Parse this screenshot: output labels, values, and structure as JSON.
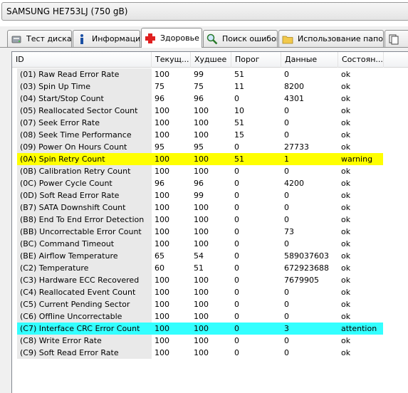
{
  "drive_selector": {
    "value": "SAMSUNG HE753LJ (750 gB)"
  },
  "tabs": [
    {
      "label": "Тест диска",
      "icon": "disk-test-icon",
      "active": false
    },
    {
      "label": "Информация",
      "icon": "info-icon",
      "active": false
    },
    {
      "label": "Здоровье",
      "icon": "health-cross-icon",
      "active": true
    },
    {
      "label": "Поиск ошибок",
      "icon": "search-icon",
      "active": false
    },
    {
      "label": "Использование папок",
      "icon": "folder-icon",
      "active": false
    },
    {
      "label": "",
      "icon": "copy-icon",
      "active": false
    }
  ],
  "columns": [
    "ID",
    "Текущ...",
    "Худшее",
    "Порог",
    "Данные",
    "Состоян..."
  ],
  "rows": [
    {
      "id": "(01) Raw Read Error Rate",
      "current": "100",
      "worst": "99",
      "threshold": "51",
      "data": "0",
      "status": "ok"
    },
    {
      "id": "(03) Spin Up Time",
      "current": "75",
      "worst": "75",
      "threshold": "11",
      "data": "8200",
      "status": "ok"
    },
    {
      "id": "(04) Start/Stop Count",
      "current": "96",
      "worst": "96",
      "threshold": "0",
      "data": "4301",
      "status": "ok"
    },
    {
      "id": "(05) Reallocated Sector Count",
      "current": "100",
      "worst": "100",
      "threshold": "10",
      "data": "0",
      "status": "ok"
    },
    {
      "id": "(07) Seek Error Rate",
      "current": "100",
      "worst": "100",
      "threshold": "51",
      "data": "0",
      "status": "ok"
    },
    {
      "id": "(08) Seek Time Performance",
      "current": "100",
      "worst": "100",
      "threshold": "15",
      "data": "0",
      "status": "ok"
    },
    {
      "id": "(09) Power On Hours Count",
      "current": "95",
      "worst": "95",
      "threshold": "0",
      "data": "27733",
      "status": "ok"
    },
    {
      "id": "(0A) Spin Retry Count",
      "current": "100",
      "worst": "100",
      "threshold": "51",
      "data": "1",
      "status": "warning"
    },
    {
      "id": "(0B) Calibration Retry Count",
      "current": "100",
      "worst": "100",
      "threshold": "0",
      "data": "0",
      "status": "ok"
    },
    {
      "id": "(0C) Power Cycle Count",
      "current": "96",
      "worst": "96",
      "threshold": "0",
      "data": "4200",
      "status": "ok"
    },
    {
      "id": "(0D) Soft Read Error Rate",
      "current": "100",
      "worst": "99",
      "threshold": "0",
      "data": "0",
      "status": "ok"
    },
    {
      "id": "(B7) SATA Downshift Count",
      "current": "100",
      "worst": "100",
      "threshold": "0",
      "data": "0",
      "status": "ok"
    },
    {
      "id": "(B8) End To End Error Detection",
      "current": "100",
      "worst": "100",
      "threshold": "0",
      "data": "0",
      "status": "ok"
    },
    {
      "id": "(BB) Uncorrectable Error Count",
      "current": "100",
      "worst": "100",
      "threshold": "0",
      "data": "73",
      "status": "ok"
    },
    {
      "id": "(BC) Command Timeout",
      "current": "100",
      "worst": "100",
      "threshold": "0",
      "data": "0",
      "status": "ok"
    },
    {
      "id": "(BE) Airflow Temperature",
      "current": "65",
      "worst": "54",
      "threshold": "0",
      "data": "589037603",
      "status": "ok"
    },
    {
      "id": "(C2) Temperature",
      "current": "60",
      "worst": "51",
      "threshold": "0",
      "data": "672923688",
      "status": "ok"
    },
    {
      "id": "(C3) Hardware ECC Recovered",
      "current": "100",
      "worst": "100",
      "threshold": "0",
      "data": "7679905",
      "status": "ok"
    },
    {
      "id": "(C4) Reallocated Event Count",
      "current": "100",
      "worst": "100",
      "threshold": "0",
      "data": "0",
      "status": "ok"
    },
    {
      "id": "(C5) Current Pending Sector",
      "current": "100",
      "worst": "100",
      "threshold": "0",
      "data": "0",
      "status": "ok"
    },
    {
      "id": "(C6) Offline Uncorrectable",
      "current": "100",
      "worst": "100",
      "threshold": "0",
      "data": "0",
      "status": "ok"
    },
    {
      "id": "(C7) Interface CRC Error Count",
      "current": "100",
      "worst": "100",
      "threshold": "0",
      "data": "3",
      "status": "attention"
    },
    {
      "id": "(C8) Write Error Rate",
      "current": "100",
      "worst": "100",
      "threshold": "0",
      "data": "0",
      "status": "ok"
    },
    {
      "id": "(C9) Soft Read Error Rate",
      "current": "100",
      "worst": "100",
      "threshold": "0",
      "data": "0",
      "status": "ok"
    }
  ],
  "colors": {
    "warning_row": "#ffff00",
    "attention_row": "#33ffff",
    "id_column_bg": "#e9e9e9"
  }
}
